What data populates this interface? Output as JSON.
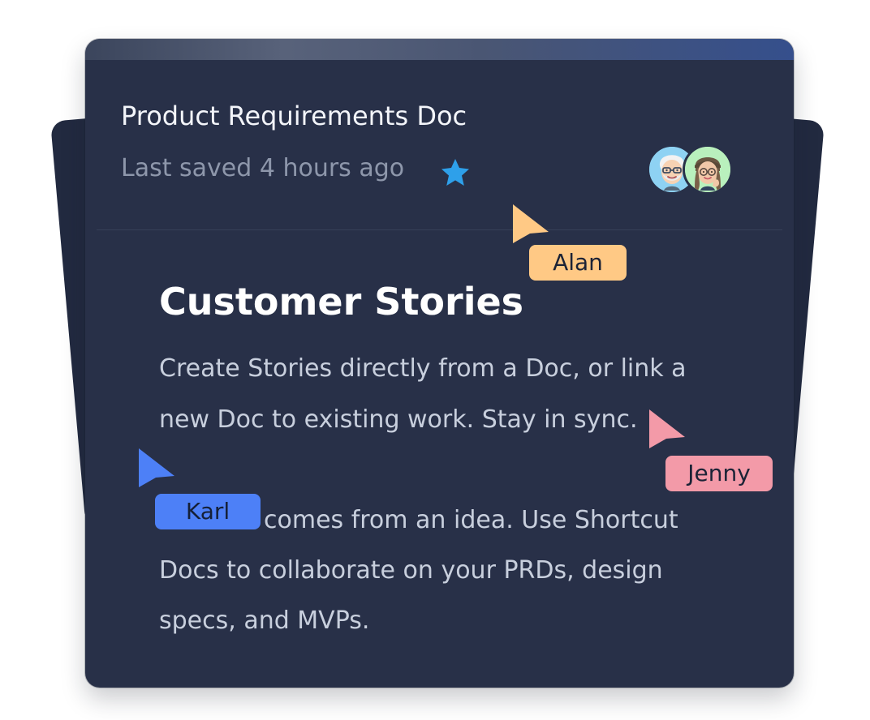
{
  "doc": {
    "title": "Product Requirements Doc",
    "saved": "Last saved 4 hours ago"
  },
  "content": {
    "heading": "Customer Stories",
    "lines": [
      "Create Stories directly from a Doc, or link a",
      "new Doc to existing work. Stay in sync.",
      "comes from an idea. Use Shortcut",
      "Docs to collaborate on your PRDs, design",
      "specs, and MVPs."
    ]
  },
  "cursors": [
    {
      "name": "Alan",
      "color": "#ffc985",
      "icon": "cursor-arrow-icon"
    },
    {
      "name": "Jenny",
      "color": "#f39aa8",
      "icon": "cursor-arrow-icon"
    },
    {
      "name": "Karl",
      "color": "#4d80f7",
      "icon": "cursor-arrow-icon"
    }
  ],
  "ui": {
    "star_icon": "star-icon",
    "avatar_icons": [
      "avatar-bearded-man-icon",
      "avatar-woman-icon"
    ],
    "colors": {
      "card": "#283048",
      "title": "#f3f5fa",
      "meta": "#8e97ab",
      "body": "#c8cfdd",
      "accent_star": "#2ea0ea"
    }
  }
}
